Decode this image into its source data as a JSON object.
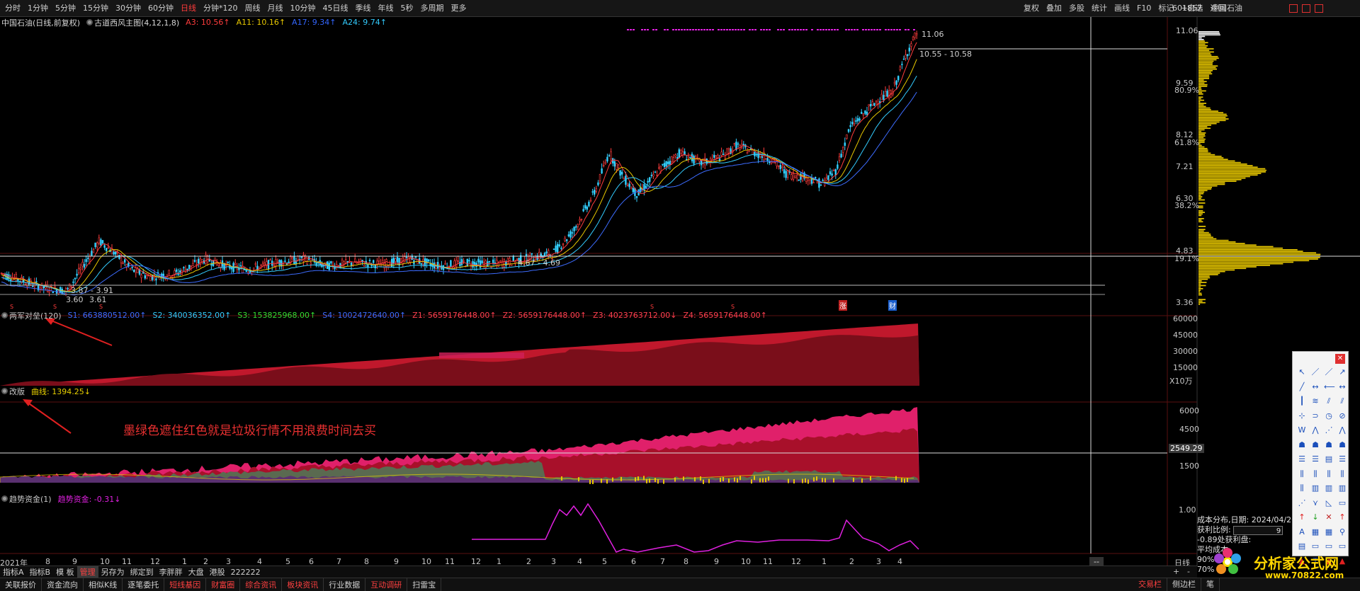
{
  "top_bar": {
    "period_tabs": [
      {
        "label": "分时",
        "active": false
      },
      {
        "label": "1分钟",
        "active": false
      },
      {
        "label": "5分钟",
        "active": false
      },
      {
        "label": "15分钟",
        "active": false
      },
      {
        "label": "30分钟",
        "active": false
      },
      {
        "label": "60分钟",
        "active": false
      },
      {
        "label": "日线",
        "active": true
      },
      {
        "label": "分钟*120",
        "active": false
      },
      {
        "label": "周线",
        "active": false
      },
      {
        "label": "月线",
        "active": false
      },
      {
        "label": "10分钟",
        "active": false
      },
      {
        "label": "45日线",
        "active": false
      },
      {
        "label": "季线",
        "active": false
      },
      {
        "label": "年线",
        "active": false
      },
      {
        "label": "5秒",
        "active": false
      },
      {
        "label": "多周期",
        "active": false
      },
      {
        "label": "更多",
        "active": false
      }
    ],
    "chart_tools": [
      "复权",
      "叠加",
      "多股",
      "统计",
      "画线",
      "F10",
      "标记",
      "+自选",
      "返回"
    ],
    "stock_code": "601857",
    "stock_name": "中国石油"
  },
  "main_panel": {
    "title": "中国石油(日线,前复权)",
    "indicator": "古道西风主图(4,12,1,8)",
    "a3": "A3: 10.56↑",
    "a11": "A11: 10.16↑",
    "a17": "A17: 9.34↑",
    "a24": "A24: 9.74↑",
    "high_label": "11.06",
    "range_high": "10.55 - 10.58",
    "range_mid": "4.67 - 4.69",
    "range_low1": "3.87 - 3.91",
    "range_low2": "3.60",
    "range_low3": "3.61",
    "marker_zhang": "涨",
    "marker_cai": "财",
    "y_ticks": [
      "11.06",
      "9.59",
      "8.12",
      "7.21",
      "6.30",
      "4.83",
      "3.36"
    ],
    "pct_ticks": [
      "80.9%",
      "61.8%",
      "38.2%",
      "19.1%"
    ]
  },
  "panel2": {
    "title": "两军对垒(120)",
    "s1": "S1: 663880512.00↑",
    "s2": "S2: 340036352.00↑",
    "s3": "S3: 153825968.00↑",
    "s4": "S4: 1002472640.00↑",
    "z1": "Z1: 5659176448.00↑",
    "z2": "Z2: 5659176448.00↑",
    "z3": "Z3: 4023763712.00↓",
    "z4": "Z4: 5659176448.00↑",
    "y_ticks": [
      "60000",
      "45000",
      "30000",
      "15000"
    ],
    "unit": "X10万"
  },
  "panel3": {
    "title": "改版",
    "curve": "曲线: 1394.25↓",
    "annotation": "墨绿色遮住红色就是垃圾行情不用浪费时间去买",
    "y_ticks": [
      "6000",
      "4500",
      "3000",
      "1500"
    ],
    "cursor_value": "2549.29"
  },
  "panel4": {
    "title": "趋势资金(1)",
    "value": "趋势资金: -0.31↓",
    "y_ticks": [
      "1.00"
    ]
  },
  "x_axis": {
    "labels": [
      "2021年",
      "8",
      "9",
      "10",
      "11",
      "12",
      "1",
      "2",
      "3",
      "4",
      "5",
      "6",
      "7",
      "8",
      "9",
      "10",
      "11",
      "12",
      "1",
      "2",
      "3",
      "4",
      "5",
      "6",
      "7",
      "8",
      "9",
      "10",
      "11",
      "12",
      "1",
      "2",
      "3",
      "4"
    ],
    "period": "日线",
    "scroll": "--"
  },
  "bottom_bar1": {
    "tabs": [
      {
        "label": "指标A",
        "active": false
      },
      {
        "label": "指标B",
        "active": false
      },
      {
        "label": "模 板",
        "active": false
      },
      {
        "label": "管理",
        "active": true
      },
      {
        "label": "另存为",
        "active": false
      },
      {
        "label": "绑定到",
        "active": false
      },
      {
        "label": "李胖胖",
        "active": false
      },
      {
        "label": "大盘",
        "active": false
      },
      {
        "label": "港股",
        "active": false
      },
      {
        "label": "222222",
        "active": false
      }
    ],
    "zoom": [
      "+",
      "-"
    ]
  },
  "bottom_bar2": {
    "tabs": [
      {
        "label": "关联报价",
        "highlight": false
      },
      {
        "label": "资金流向",
        "highlight": false
      },
      {
        "label": "相似K线",
        "highlight": false
      },
      {
        "label": "逐笔委托",
        "highlight": false
      },
      {
        "label": "短线基因",
        "highlight": true
      },
      {
        "label": "财富圈",
        "highlight": true
      },
      {
        "label": "综合资讯",
        "highlight": true
      },
      {
        "label": "板块资讯",
        "highlight": true
      },
      {
        "label": "行业数据",
        "highlight": false
      },
      {
        "label": "互动调研",
        "highlight": true
      },
      {
        "label": "扫雷宝",
        "highlight": false
      }
    ],
    "right_tabs": [
      "交易栏",
      "侧边栏",
      "笔"
    ]
  },
  "cost_panel": {
    "date_line": "成本分布,日期: 2024/04/26",
    "ratio_label": "获利比例:",
    "ratio_value": "9",
    "line3": "-0.89处获利盘:",
    "line4": "平均成本",
    "line5": "90%",
    "line6": "70%"
  },
  "logo": {
    "title": "分析家公式网",
    "url": "www.70822.com"
  },
  "colors": {
    "up": "#ff3c3c",
    "down": "#33ccff",
    "magenta": "#e020e0",
    "yellow": "#e8c800"
  }
}
